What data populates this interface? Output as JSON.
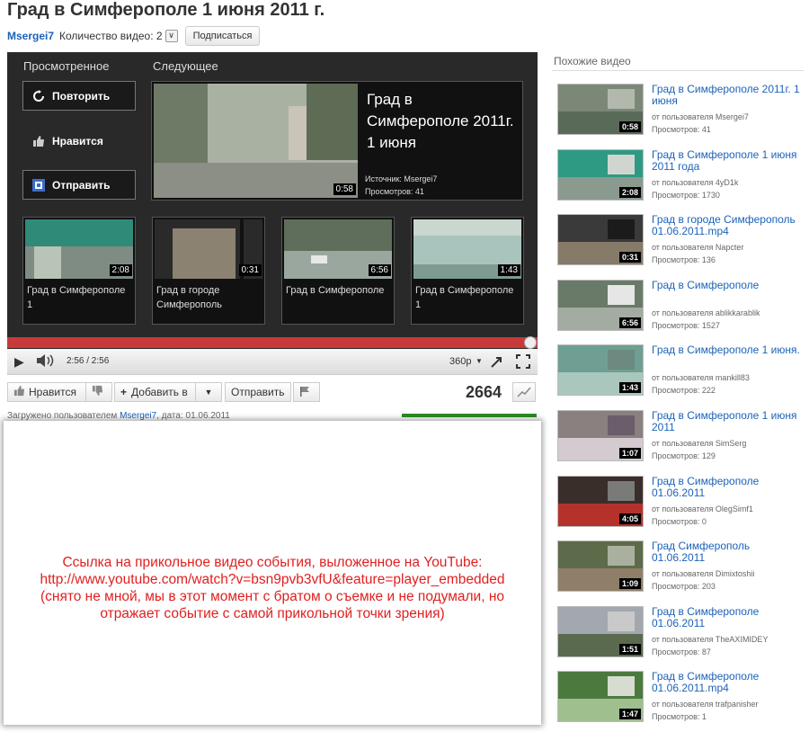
{
  "title": "Град в Симферополе 1 июня 2011 г.",
  "owner": {
    "name": "Msergei7",
    "video_count": "Количество видео: 2",
    "subscribe_label": "Подписаться"
  },
  "player": {
    "watched_label": "Просмотренное",
    "next_label": "Следующее",
    "replay_label": "Повторить",
    "like_label": "Нравится",
    "share_label": "Отправить",
    "next_video": {
      "title": "Град в Симферополе 2011г. 1 июня",
      "duration": "0:58",
      "source": "Источник:    Msergei7",
      "views": "Просмотров:   41"
    },
    "grid": [
      {
        "title": "Град в Симферополе 1",
        "duration": "2:08"
      },
      {
        "title": "Град в городе Симферополь",
        "duration": "0:31"
      },
      {
        "title": "Град в Симферополе",
        "duration": "6:56"
      },
      {
        "title": "Град в Симферополе 1",
        "duration": "1:43"
      }
    ],
    "progress": 1.0,
    "time": "2:56 / 2:56",
    "quality": "360p"
  },
  "actions": {
    "like": "Нравится",
    "add_to": "Добавить в",
    "share": "Отправить",
    "views": "2664"
  },
  "uploaded": {
    "prefix": "Загружено пользователем ",
    "user": "Msergei7",
    "date": ", дата: 01.06.2011"
  },
  "description": {
    "lines": [
      "Ссылка на прикольное видео события, выложенное на YouTube:",
      "http://www.youtube.com/watch?v=bsn9pvb3vfU&feature=player_embedded",
      "(снято не мной, мы в этот момент с братом о съемке и не подумали, но",
      "отражает событие с самой прикольной точки зрения)"
    ],
    "color": "#e02020"
  },
  "related": {
    "header": "Похожие видео",
    "items": [
      {
        "title": "Град в Симферополе 2011г. 1 июня",
        "by": "от пользователя Msergei7",
        "views": "Просмотров: 41",
        "duration": "0:58"
      },
      {
        "title": "Град в Симферополе 1 июня 2011 года",
        "by": "от пользователя 4yD1k",
        "views": "Просмотров: 1730",
        "duration": "2:08"
      },
      {
        "title": "Град в городе Симферополь 01.06.2011.mp4",
        "by": "от пользователя Napcter",
        "views": "Просмотров: 136",
        "duration": "0:31"
      },
      {
        "title": "Град в Симферополе",
        "by": "от пользователя ablikkarablik",
        "views": "Просмотров: 1527",
        "duration": "6:56"
      },
      {
        "title": "Град в Симферополе 1 июня.",
        "by": "от пользователя mankill83",
        "views": "Просмотров: 222",
        "duration": "1:43"
      },
      {
        "title": "Град в Симферополе 1 июня 2011",
        "by": "от пользователя SimSerg",
        "views": "Просмотров: 129",
        "duration": "1:07"
      },
      {
        "title": "Град в Симферополе 01.06.2011",
        "by": "от пользователя OlegSimf1",
        "views": "Просмотров: 0",
        "duration": "4:05"
      },
      {
        "title": "Град Симферополь 01.06.2011",
        "by": "от пользователя Dimixtoshii",
        "views": "Просмотров: 203",
        "duration": "1:09"
      },
      {
        "title": "Град в Симферополе 01.06.2011",
        "by": "от пользователя TheAXIMIDEY",
        "views": "Просмотров: 87",
        "duration": "1:51"
      },
      {
        "title": "Град в Симферополе 01.06.2011.mp4",
        "by": "от пользователя trafpanisher",
        "views": "Просмотров: 1",
        "duration": "1:47"
      }
    ]
  }
}
